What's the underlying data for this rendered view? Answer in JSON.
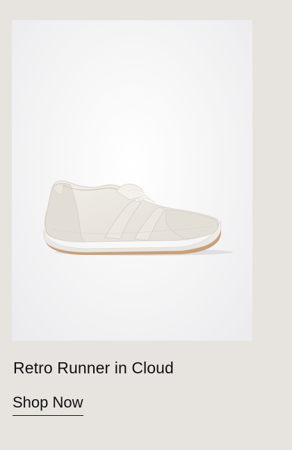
{
  "product": {
    "name": "Retro Runner in Cloud",
    "cta_label": "Shop Now",
    "image_subject": "white-retro-running-sneaker"
  },
  "colors": {
    "page_background": "#e7e4e0",
    "image_background": "#f1f1f2",
    "text": "#111111"
  }
}
